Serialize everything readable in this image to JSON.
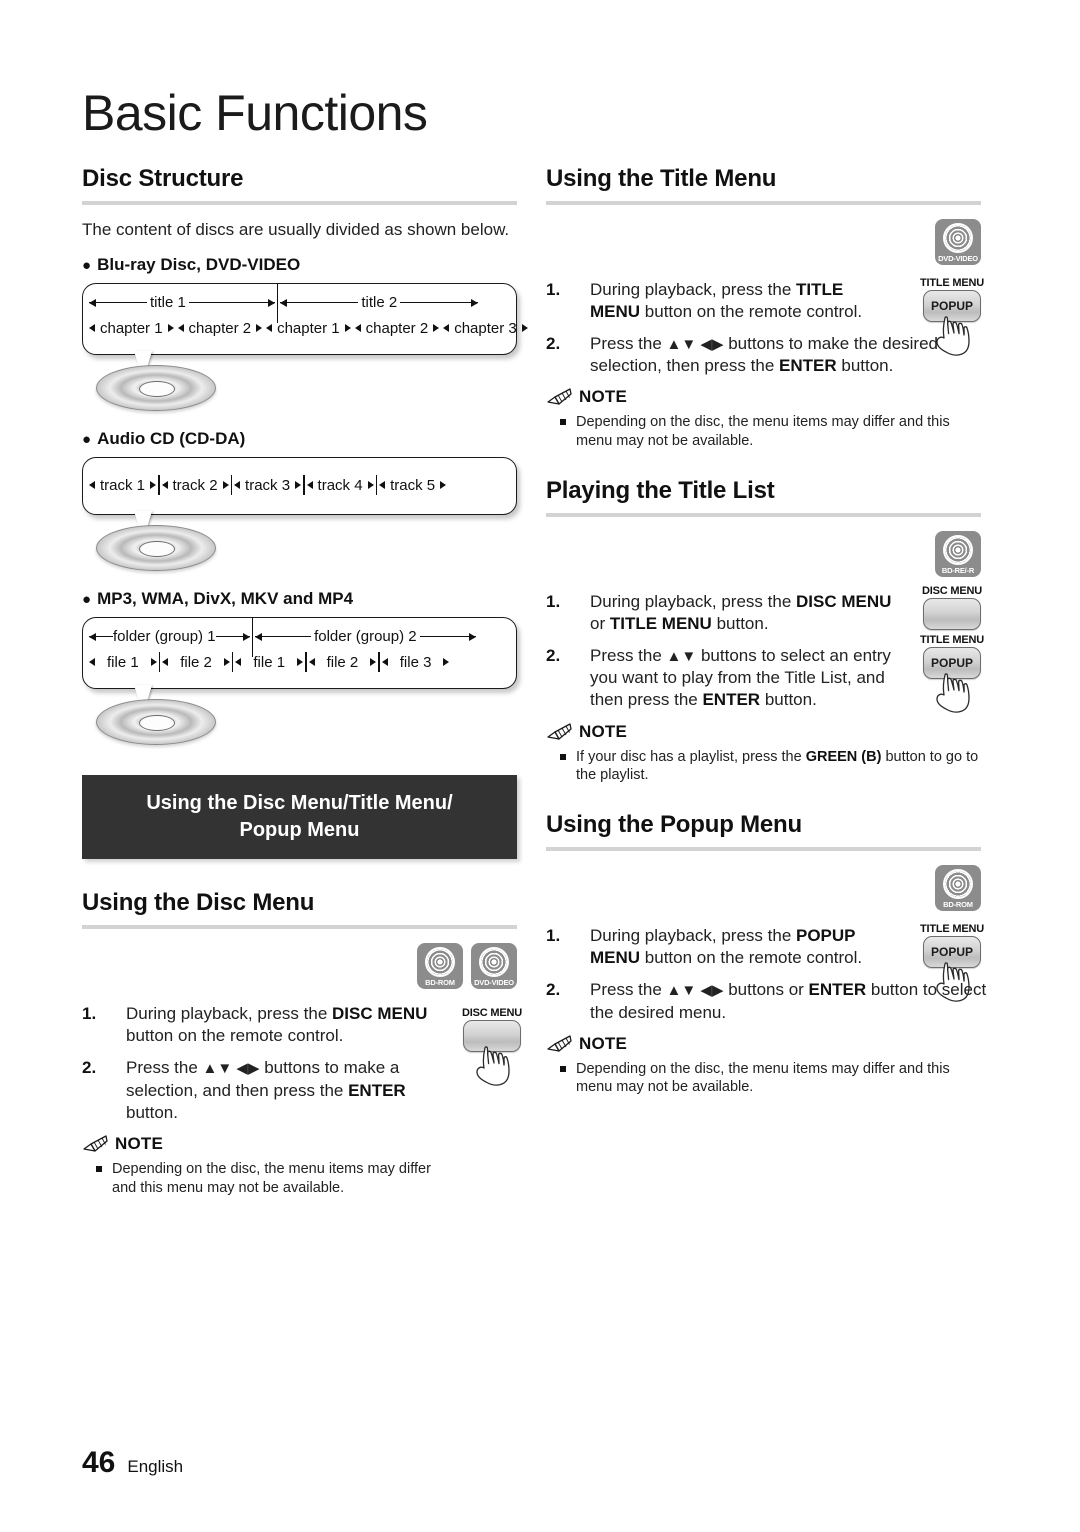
{
  "chapter": {
    "title": "Basic Functions"
  },
  "footer": {
    "page_number": "46",
    "language": "English"
  },
  "left": {
    "disc_structure": {
      "heading": "Disc Structure",
      "intro": "The content of discs are usually divided as shown below.",
      "group_bd": {
        "label": "Blu-ray Disc, DVD-VIDEO",
        "titles": [
          "title 1",
          "title 2"
        ],
        "chapters": [
          "chapter 1",
          "chapter 2",
          "chapter 1",
          "chapter 2",
          "chapter 3"
        ]
      },
      "group_cd": {
        "label": "Audio CD (CD-DA)",
        "tracks": [
          "track 1",
          "track 2",
          "track 3",
          "track 4",
          "track 5"
        ]
      },
      "group_files": {
        "label": "MP3, WMA, DivX, MKV and MP4",
        "folders": [
          "folder (group) 1",
          "folder (group) 2"
        ],
        "files": [
          "file 1",
          "file 2",
          "file 1",
          "file 2",
          "file 3"
        ]
      }
    },
    "banner": {
      "line1": "Using the Disc Menu/Title Menu/",
      "line2": "Popup Menu"
    },
    "disc_menu": {
      "heading": "Using the Disc Menu",
      "badges": [
        {
          "icon": "disc-icon",
          "label": "BD-ROM"
        },
        {
          "icon": "disc-icon",
          "label": "DVD-VIDEO"
        }
      ],
      "key": {
        "label": "DISC MENU",
        "face": ""
      },
      "steps": [
        {
          "num": "1.",
          "html": "During playback, press the <b>DISC MENU</b> button on the remote control."
        },
        {
          "num": "2.",
          "html": "Press the <span class=\"arrows\">▲▼ ◀▶</span> buttons to make a selection, and then press the <b>ENTER</b> button."
        }
      ],
      "note_label": "NOTE",
      "notes": [
        "Depending on the disc, the menu items may differ and this menu may not be available."
      ]
    }
  },
  "right": {
    "title_menu": {
      "heading": "Using the Title Menu",
      "badges": [
        {
          "icon": "disc-icon",
          "label": "DVD-VIDEO"
        }
      ],
      "key": {
        "label": "TITLE MENU",
        "face": "POPUP"
      },
      "steps": [
        {
          "num": "1.",
          "html": "During playback, press the <b>TITLE MENU</b> button on the remote control."
        },
        {
          "num": "2.",
          "html": "Press the <span class=\"arrows\">▲▼ ◀▶</span> buttons to make the desired selection, then press the <b>ENTER</b> button."
        }
      ],
      "note_label": "NOTE",
      "notes": [
        "Depending on the disc, the menu items may differ and this menu may not be available."
      ]
    },
    "title_list": {
      "heading": "Playing the Title List",
      "badges": [
        {
          "icon": "disc-icon",
          "label": "BD-RE/-R"
        }
      ],
      "key1": {
        "label": "DISC MENU",
        "face": ""
      },
      "key2": {
        "label": "TITLE MENU",
        "face": "POPUP"
      },
      "steps": [
        {
          "num": "1.",
          "html": "During playback, press the <b>DISC MENU</b> or <b>TITLE MENU</b> button."
        },
        {
          "num": "2.",
          "html": "Press the <span class=\"arrows\">▲▼</span> buttons to select an entry you want to play from the Title List, and then press the <b>ENTER</b> button."
        }
      ],
      "note_label": "NOTE",
      "notes": [
        "If your disc has a playlist, press the <b>GREEN (B)</b> button to go to the playlist."
      ]
    },
    "popup_menu": {
      "heading": "Using the Popup Menu",
      "badges": [
        {
          "icon": "disc-icon",
          "label": "BD-ROM"
        }
      ],
      "key": {
        "label": "TITLE MENU",
        "face": "POPUP"
      },
      "steps": [
        {
          "num": "1.",
          "html": "During playback, press the <b>POPUP MENU</b> button on the remote control."
        },
        {
          "num": "2.",
          "html": "Press the <span class=\"arrows\">▲▼ ◀▶</span> buttons or <b>ENTER</b> button to select the desired menu."
        }
      ],
      "note_label": "NOTE",
      "notes": [
        "Depending on the disc, the menu items may differ and this menu may not be available."
      ]
    }
  }
}
